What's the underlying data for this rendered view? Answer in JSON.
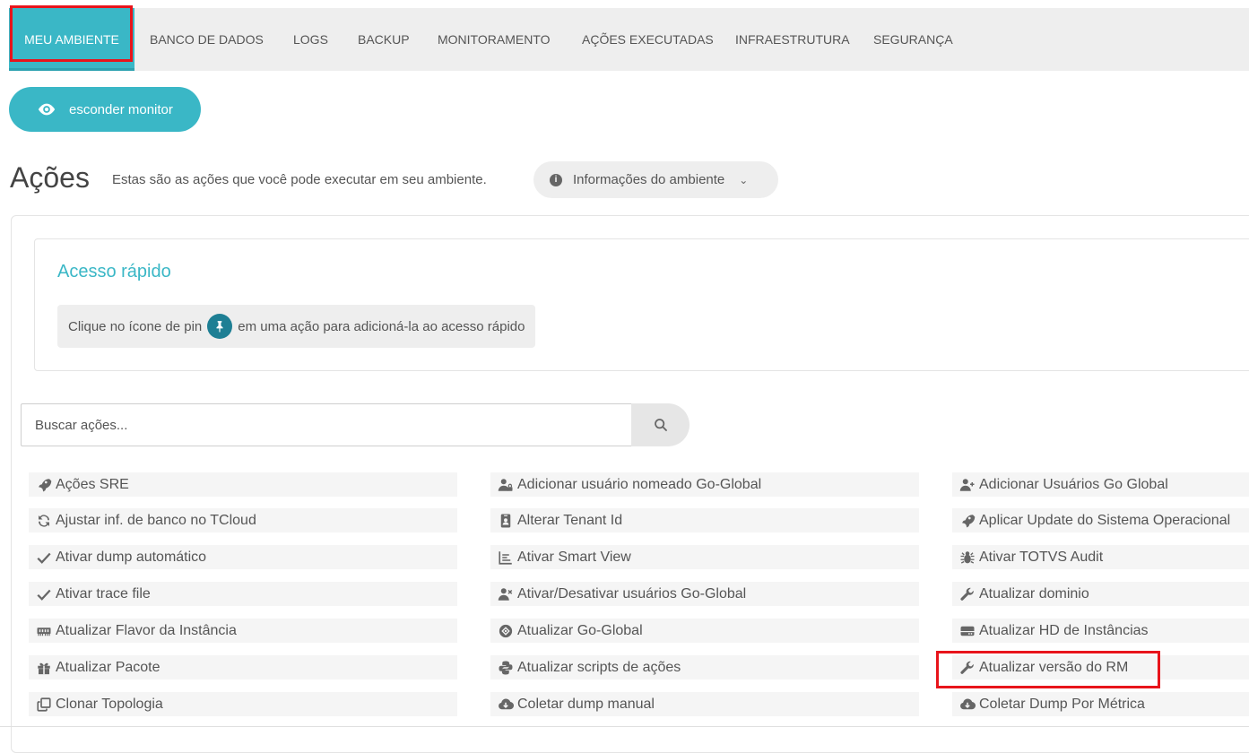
{
  "nav": {
    "tabs": [
      {
        "label": "MEU AMBIENTE",
        "active": true
      },
      {
        "label": "BANCO DE DADOS"
      },
      {
        "label": "LOGS"
      },
      {
        "label": "BACKUP"
      },
      {
        "label": "MONITORAMENTO"
      },
      {
        "label": "AÇÕES EXECUTADAS"
      },
      {
        "label": "INFRAESTRUTURA"
      },
      {
        "label": "SEGURANÇA"
      }
    ]
  },
  "monitor_button": {
    "label": "esconder monitor",
    "icon": "eye-icon"
  },
  "header": {
    "title": "Ações",
    "subtitle": "Estas são as ações que você pode executar em seu ambiente.",
    "env_info_label": "Informações do ambiente"
  },
  "quick_access": {
    "title": "Acesso rápido",
    "hint_before": "Clique no ícone de pin",
    "hint_after": "em uma ação para adicioná-la ao acesso rápido"
  },
  "search": {
    "placeholder": "Buscar ações..."
  },
  "actions": [
    {
      "label": "Ações SRE",
      "icon": "rocket-icon"
    },
    {
      "label": "Adicionar usuário nomeado Go-Global",
      "icon": "user-lock-icon"
    },
    {
      "label": "Adicionar Usuários Go Global",
      "icon": "user-plus-icon"
    },
    {
      "label": "Ajustar inf. de banco no TCloud",
      "icon": "sync-icon"
    },
    {
      "label": "Alterar Tenant Id",
      "icon": "id-badge-icon"
    },
    {
      "label": "Aplicar Update do Sistema Operacional",
      "icon": "rocket-icon"
    },
    {
      "label": "Ativar dump automático",
      "icon": "check-icon"
    },
    {
      "label": "Ativar Smart View",
      "icon": "chart-icon"
    },
    {
      "label": "Ativar TOTVS Audit",
      "icon": "bug-icon"
    },
    {
      "label": "Ativar trace file",
      "icon": "check-icon"
    },
    {
      "label": "Ativar/Desativar usuários Go-Global",
      "icon": "user-times-icon"
    },
    {
      "label": "Atualizar dominio",
      "icon": "wrench-icon"
    },
    {
      "label": "Atualizar Flavor da Instância",
      "icon": "memory-icon"
    },
    {
      "label": "Atualizar Go-Global",
      "icon": "globe-icon"
    },
    {
      "label": "Atualizar HD de Instâncias",
      "icon": "hdd-icon"
    },
    {
      "label": "Atualizar Pacote",
      "icon": "gift-icon"
    },
    {
      "label": "Atualizar scripts de ações",
      "icon": "python-icon"
    },
    {
      "label": "Atualizar versão do RM",
      "icon": "wrench-icon"
    },
    {
      "label": "Clonar Topologia",
      "icon": "clone-icon"
    },
    {
      "label": "Coletar dump manual",
      "icon": "cloud-download-icon"
    },
    {
      "label": "Coletar Dump Por Métrica",
      "icon": "cloud-download-icon"
    }
  ],
  "colors": {
    "accent": "#3ab7c6",
    "pin": "#1e7f94",
    "highlight": "#e8141b"
  }
}
